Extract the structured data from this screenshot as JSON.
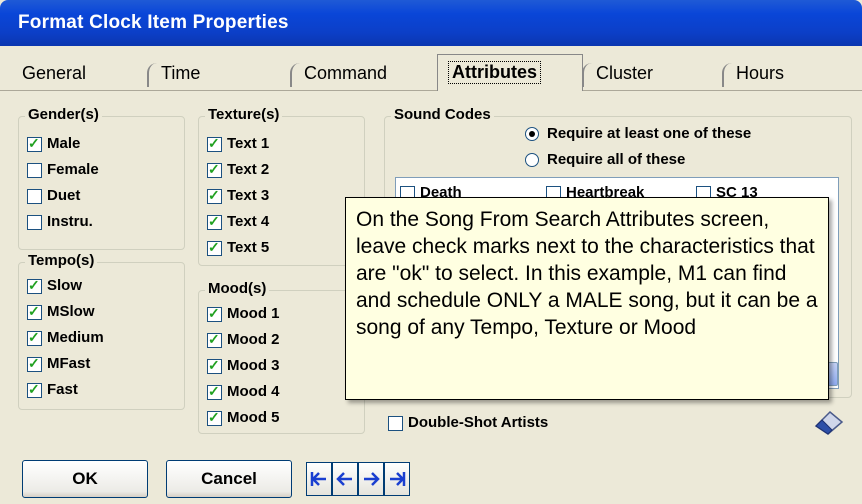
{
  "window": {
    "title": "Format Clock Item Properties"
  },
  "tabs": [
    {
      "label": "General"
    },
    {
      "label": "Time"
    },
    {
      "label": "Command"
    },
    {
      "label": "Attributes"
    },
    {
      "label": "Cluster"
    },
    {
      "label": "Hours"
    }
  ],
  "genders": {
    "title": "Gender(s)",
    "items": [
      {
        "label": "Male",
        "checked": true
      },
      {
        "label": "Female",
        "checked": false
      },
      {
        "label": "Duet",
        "checked": false
      },
      {
        "label": "Instru.",
        "checked": false
      }
    ]
  },
  "tempos": {
    "title": "Tempo(s)",
    "items": [
      {
        "label": "Slow",
        "checked": true
      },
      {
        "label": "MSlow",
        "checked": true
      },
      {
        "label": "Medium",
        "checked": true
      },
      {
        "label": "MFast",
        "checked": true
      },
      {
        "label": "Fast",
        "checked": true
      }
    ]
  },
  "textures": {
    "title": "Texture(s)",
    "items": [
      {
        "label": "Text 1",
        "checked": true
      },
      {
        "label": "Text 2",
        "checked": true
      },
      {
        "label": "Text 3",
        "checked": true
      },
      {
        "label": "Text 4",
        "checked": true
      },
      {
        "label": "Text 5",
        "checked": true
      }
    ]
  },
  "moods": {
    "title": "Mood(s)",
    "items": [
      {
        "label": "Mood 1",
        "checked": true
      },
      {
        "label": "Mood 2",
        "checked": true
      },
      {
        "label": "Mood 3",
        "checked": true
      },
      {
        "label": "Mood 4",
        "checked": true
      },
      {
        "label": "Mood 5",
        "checked": true
      }
    ]
  },
  "sound_codes": {
    "title": "Sound Codes",
    "radio_any": "Require at least one of these",
    "radio_all": "Require all of these",
    "selected": "any",
    "items": [
      {
        "label": "Death",
        "checked": false
      },
      {
        "label": "Heartbreak",
        "checked": false
      },
      {
        "label": "SC 13",
        "checked": false
      }
    ]
  },
  "double_shot": {
    "label": "Double-Shot Artists",
    "checked": false
  },
  "tooltip": {
    "text": "On the Song From Search Attributes screen, leave check marks next to the characteristics that are \"ok\" to select.  In this example, M1 can find and schedule ONLY a MALE song, but it can be a song of any Tempo, Texture or Mood"
  },
  "buttons": {
    "ok": "OK",
    "cancel": "Cancel"
  },
  "icons": {
    "first": "first-record-icon",
    "prev": "previous-record-icon",
    "next": "next-record-icon",
    "last": "last-record-icon",
    "eraser": "eraser-icon"
  },
  "colors": {
    "title_bar": "#0a46d8",
    "tooltip_bg": "#ffffe1",
    "check": "#21a121",
    "nav_arrow": "#1a3fd0"
  }
}
